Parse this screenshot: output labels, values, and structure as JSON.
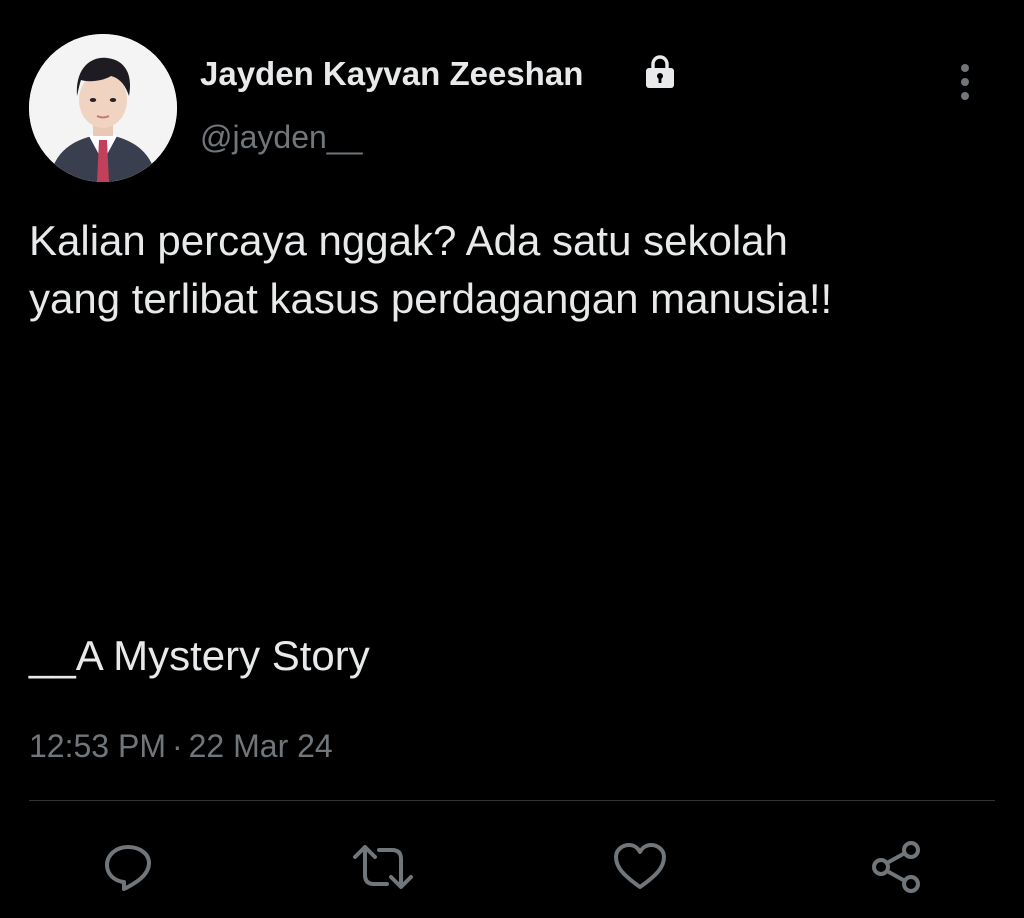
{
  "tweet": {
    "author": {
      "display_name": "Jayden Kayvan Zeeshan",
      "handle": "@jayden__",
      "protected_icon": "lock-icon",
      "avatar": "profile-photo"
    },
    "text_lines": [
      "Kalian percaya nggak? Ada satu sekolah",
      "yang terlibat kasus perdagangan manusia!!"
    ],
    "story_line": "__A Mystery Story",
    "time": "12:53 PM",
    "separator": "·",
    "date": "22 Mar 24",
    "menu_icon": "more-vertical-icon"
  },
  "actions": [
    {
      "name": "reply",
      "icon": "reply-icon"
    },
    {
      "name": "retweet",
      "icon": "retweet-icon"
    },
    {
      "name": "like",
      "icon": "heart-icon"
    },
    {
      "name": "share",
      "icon": "share-icon"
    }
  ],
  "colors": {
    "background": "#000000",
    "primary_text": "#e7e9ea",
    "secondary_text": "#71767b",
    "divider": "#2f3336"
  }
}
